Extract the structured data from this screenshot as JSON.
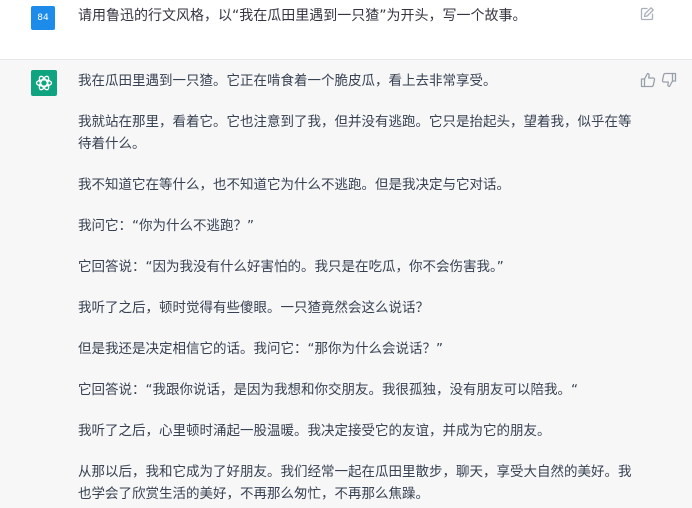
{
  "user_message": {
    "avatar_text": "84",
    "text": "请用鲁迅的行文风格，以“我在瓜田里遇到一只猹”为开头，写一个故事。"
  },
  "assistant_message": {
    "paragraphs": [
      "我在瓜田里遇到一只猹。它正在啃食着一个脆皮瓜，看上去非常享受。",
      "我就站在那里，看着它。它也注意到了我，但并没有逃跑。它只是抬起头，望着我，似乎在等待着什么。",
      "我不知道它在等什么，也不知道它为什么不逃跑。但是我决定与它对话。",
      "我问它：“你为什么不逃跑？”",
      "它回答说：“因为我没有什么好害怕的。我只是在吃瓜，你不会伤害我。”",
      "我听了之后，顿时觉得有些傻眼。一只猹竟然会这么说话？",
      "但是我还是决定相信它的话。我问它：“那你为什么会说话？”",
      "它回答说：“我跟你说话，是因为我想和你交朋友。我很孤独，没有朋友可以陪我。“",
      "我听了之后，心里顿时涌起一股温暖。我决定接受它的友谊，并成为它的朋友。",
      "从那以后，我和它成为了好朋友。我们经常一起在瓜田里散步，聊天，享受大自然的美好。我也学会了欣赏生活的美好，不再那么匆忙，不再那么焦躁。"
    ]
  },
  "icons": {
    "edit": "edit-icon",
    "thumbs_up": "thumbs-up-icon",
    "thumbs_down": "thumbs-down-icon",
    "bot_logo": "openai-logo-icon"
  },
  "colors": {
    "user_avatar_bg": "#1d8be9",
    "bot_avatar_bg": "#10a37f",
    "assistant_bg": "#f7f7f8",
    "text": "#374151"
  }
}
